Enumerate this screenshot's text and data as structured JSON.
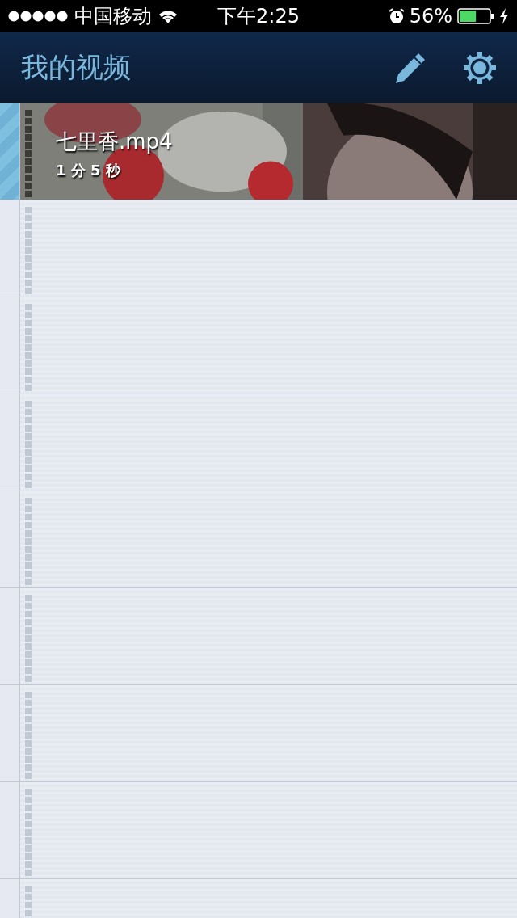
{
  "status_bar": {
    "carrier": "中国移动",
    "time": "下午2:25",
    "battery": "56%"
  },
  "nav_bar": {
    "title": "我的视频"
  },
  "videos": [
    {
      "title": "七里香.mp4",
      "duration": "1 分 5 秒",
      "selected": true,
      "kind": "picture"
    }
  ]
}
